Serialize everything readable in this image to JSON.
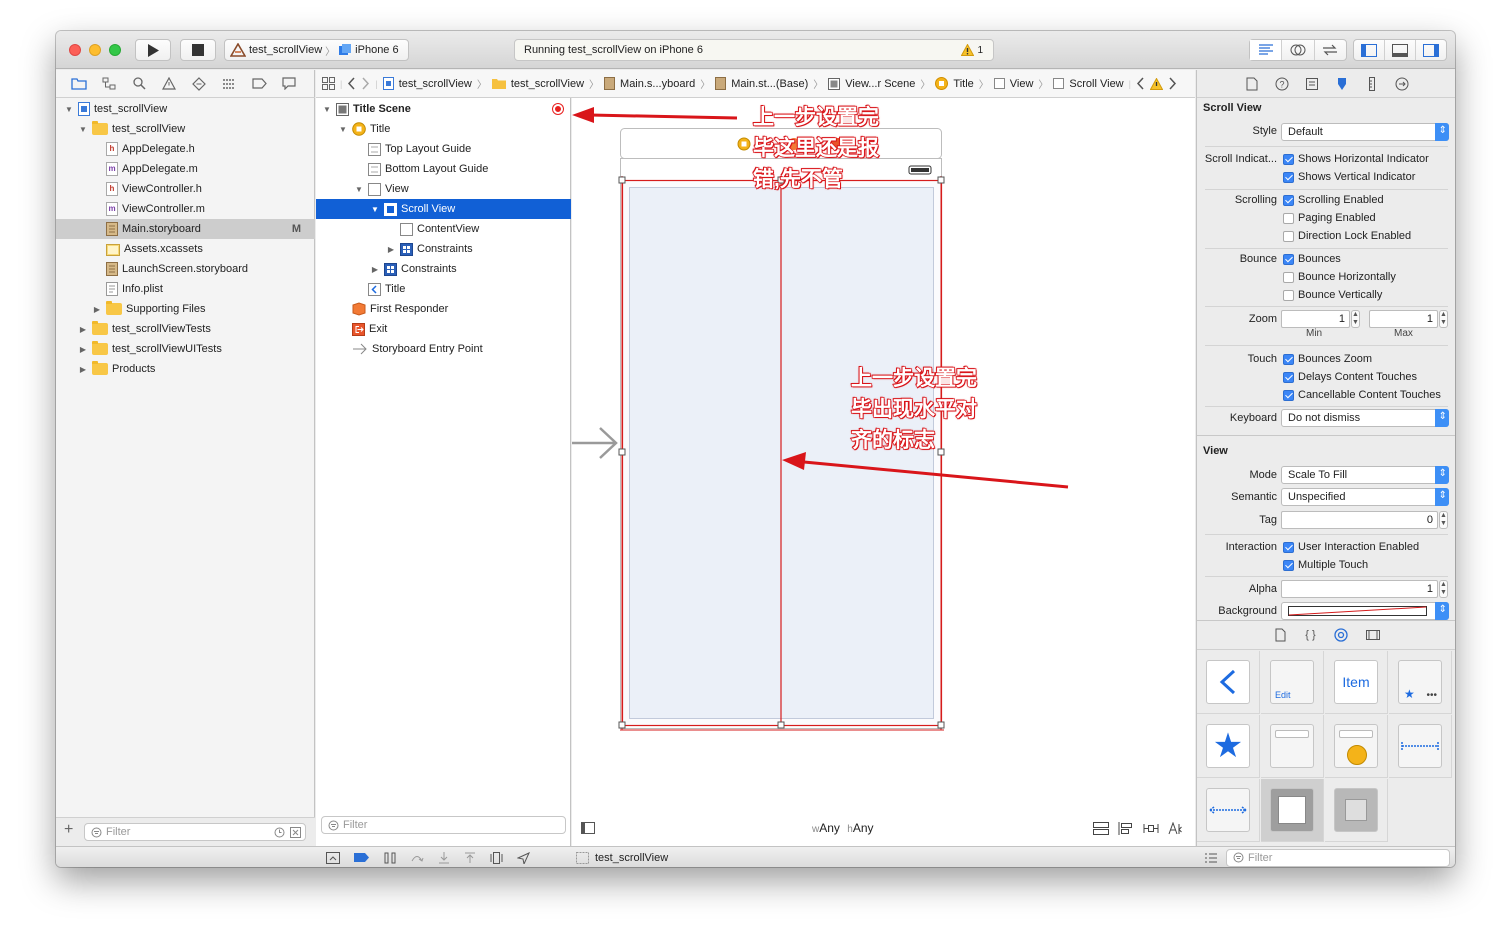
{
  "toolbar": {
    "scheme_target": "test_scrollView",
    "scheme_device": "iPhone 6",
    "activity_text": "Running test_scrollView on iPhone 6",
    "warning_count": "1"
  },
  "navigator": {
    "items": [
      {
        "label": "test_scrollView",
        "icon": "project-icon",
        "level": 0,
        "disclosure": "open"
      },
      {
        "label": "test_scrollView",
        "icon": "folder-icon",
        "level": 1,
        "disclosure": "open"
      },
      {
        "label": "AppDelegate.h",
        "icon": "header-file-icon",
        "glyph": "h",
        "level": 2
      },
      {
        "label": "AppDelegate.m",
        "icon": "implementation-file-icon",
        "glyph": "m",
        "level": 2
      },
      {
        "label": "ViewController.h",
        "icon": "header-file-icon",
        "glyph": "h",
        "level": 2
      },
      {
        "label": "ViewController.m",
        "icon": "implementation-file-icon",
        "glyph": "m",
        "level": 2
      },
      {
        "label": "Main.storyboard",
        "icon": "storyboard-file-icon",
        "level": 2,
        "selected": true,
        "badge": "M"
      },
      {
        "label": "Assets.xcassets",
        "icon": "asset-catalog-icon",
        "level": 2
      },
      {
        "label": "LaunchScreen.storyboard",
        "icon": "storyboard-file-icon",
        "level": 2
      },
      {
        "label": "Info.plist",
        "icon": "plist-file-icon",
        "level": 2
      },
      {
        "label": "Supporting Files",
        "icon": "folder-icon",
        "level": 2,
        "disclosure": "closed"
      },
      {
        "label": "test_scrollViewTests",
        "icon": "folder-icon",
        "level": 1,
        "disclosure": "closed"
      },
      {
        "label": "test_scrollViewUITests",
        "icon": "folder-icon",
        "level": 1,
        "disclosure": "closed"
      },
      {
        "label": "Products",
        "icon": "folder-icon",
        "level": 1,
        "disclosure": "closed"
      }
    ],
    "filter_placeholder": "Filter"
  },
  "jumpbar": {
    "crumbs": [
      "test_scrollView",
      "test_scrollView",
      "Main.s...yboard",
      "Main.st...(Base)",
      "View...r Scene",
      "Title",
      "View",
      "Scroll View"
    ]
  },
  "outline": {
    "items": [
      {
        "label": "Title Scene",
        "level": 0,
        "bold": true,
        "disclosure": "open",
        "icon": "scene-icon"
      },
      {
        "label": "Title",
        "level": 1,
        "disclosure": "open",
        "icon": "view-controller-icon"
      },
      {
        "label": "Top Layout Guide",
        "level": 2,
        "icon": "layout-guide-icon"
      },
      {
        "label": "Bottom Layout Guide",
        "level": 2,
        "icon": "layout-guide-icon"
      },
      {
        "label": "View",
        "level": 2,
        "disclosure": "open",
        "icon": "view-icon"
      },
      {
        "label": "Scroll View",
        "level": 3,
        "disclosure": "open",
        "icon": "scroll-view-icon",
        "selected": true
      },
      {
        "label": "ContentView",
        "level": 4,
        "icon": "view-icon"
      },
      {
        "label": "Constraints",
        "level": 4,
        "disclosure": "closed",
        "icon": "constraints-icon"
      },
      {
        "label": "Constraints",
        "level": 3,
        "disclosure": "closed",
        "icon": "constraints-icon"
      },
      {
        "label": "Title",
        "level": 2,
        "icon": "navigation-item-icon"
      },
      {
        "label": "First Responder",
        "level": 1,
        "icon": "first-responder-icon"
      },
      {
        "label": "Exit",
        "level": 1,
        "icon": "exit-icon"
      },
      {
        "label": "Storyboard Entry Point",
        "level": 1,
        "icon": "entry-point-arrow-icon"
      }
    ],
    "filter_placeholder": "Filter"
  },
  "canvas": {
    "size_class_w": "w",
    "size_class_w_value": "Any",
    "size_class_h": "h",
    "size_class_h_value": "Any"
  },
  "annotations": {
    "top_lines": [
      "上一步设置完",
      "毕这里还是报",
      "错,先不管"
    ],
    "mid_lines": [
      "上一步设置完",
      "毕出现水平对",
      "齐的标志"
    ],
    "color": "#d9151a"
  },
  "inspector": {
    "scroll_view_title": "Scroll View",
    "style_label": "Style",
    "style_value": "Default",
    "indicators_label": "Scroll Indicat...",
    "shows_horizontal": "Shows Horizontal Indicator",
    "shows_vertical": "Shows Vertical Indicator",
    "scrolling_label": "Scrolling",
    "scrolling_enabled": "Scrolling Enabled",
    "paging_enabled": "Paging Enabled",
    "direction_lock": "Direction Lock Enabled",
    "bounce_label": "Bounce",
    "bounces": "Bounces",
    "bounce_horizontally": "Bounce Horizontally",
    "bounce_vertically": "Bounce Vertically",
    "zoom_label": "Zoom",
    "zoom_min": "1",
    "zoom_max": "1",
    "zoom_min_label": "Min",
    "zoom_max_label": "Max",
    "touch_label": "Touch",
    "bounces_zoom": "Bounces Zoom",
    "delays_content_touches": "Delays Content Touches",
    "cancellable_content_touches": "Cancellable Content Touches",
    "keyboard_label": "Keyboard",
    "keyboard_value": "Do not dismiss",
    "view_title": "View",
    "mode_label": "Mode",
    "mode_value": "Scale To Fill",
    "semantic_label": "Semantic",
    "semantic_value": "Unspecified",
    "tag_label": "Tag",
    "tag_value": "0",
    "interaction_label": "Interaction",
    "user_interaction": "User Interaction Enabled",
    "multiple_touch": "Multiple Touch",
    "alpha_label": "Alpha",
    "alpha_value": "1",
    "background_label": "Background",
    "checkboxes": {
      "shows_horizontal": true,
      "shows_vertical": true,
      "scrolling_enabled": true,
      "paging_enabled": false,
      "direction_lock": false,
      "bounces": true,
      "bounce_horizontally": false,
      "bounce_vertically": false,
      "bounces_zoom": true,
      "delays_content_touches": true,
      "cancellable_content_touches": true,
      "user_interaction": true,
      "multiple_touch": true
    }
  },
  "library": {
    "item_label": "Item",
    "edit_label": "Edit",
    "filter_placeholder": "Filter"
  },
  "statusbar": {
    "debug_target": "test_scrollView"
  },
  "colors": {
    "accent": "#3b86f7",
    "selection": "#1160d6",
    "constraint_red": "#d61c1c"
  }
}
